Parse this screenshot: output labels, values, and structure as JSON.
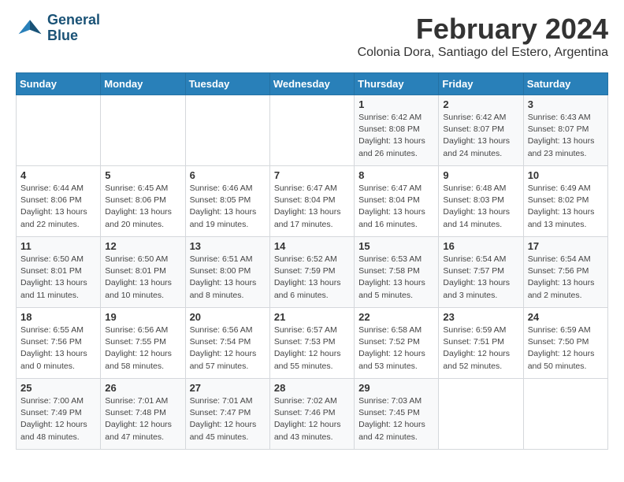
{
  "logo": {
    "line1": "General",
    "line2": "Blue"
  },
  "title": "February 2024",
  "location": "Colonia Dora, Santiago del Estero, Argentina",
  "days_of_week": [
    "Sunday",
    "Monday",
    "Tuesday",
    "Wednesday",
    "Thursday",
    "Friday",
    "Saturday"
  ],
  "weeks": [
    [
      {
        "day": "",
        "info": ""
      },
      {
        "day": "",
        "info": ""
      },
      {
        "day": "",
        "info": ""
      },
      {
        "day": "",
        "info": ""
      },
      {
        "day": "1",
        "info": "Sunrise: 6:42 AM\nSunset: 8:08 PM\nDaylight: 13 hours\nand 26 minutes."
      },
      {
        "day": "2",
        "info": "Sunrise: 6:42 AM\nSunset: 8:07 PM\nDaylight: 13 hours\nand 24 minutes."
      },
      {
        "day": "3",
        "info": "Sunrise: 6:43 AM\nSunset: 8:07 PM\nDaylight: 13 hours\nand 23 minutes."
      }
    ],
    [
      {
        "day": "4",
        "info": "Sunrise: 6:44 AM\nSunset: 8:06 PM\nDaylight: 13 hours\nand 22 minutes."
      },
      {
        "day": "5",
        "info": "Sunrise: 6:45 AM\nSunset: 8:06 PM\nDaylight: 13 hours\nand 20 minutes."
      },
      {
        "day": "6",
        "info": "Sunrise: 6:46 AM\nSunset: 8:05 PM\nDaylight: 13 hours\nand 19 minutes."
      },
      {
        "day": "7",
        "info": "Sunrise: 6:47 AM\nSunset: 8:04 PM\nDaylight: 13 hours\nand 17 minutes."
      },
      {
        "day": "8",
        "info": "Sunrise: 6:47 AM\nSunset: 8:04 PM\nDaylight: 13 hours\nand 16 minutes."
      },
      {
        "day": "9",
        "info": "Sunrise: 6:48 AM\nSunset: 8:03 PM\nDaylight: 13 hours\nand 14 minutes."
      },
      {
        "day": "10",
        "info": "Sunrise: 6:49 AM\nSunset: 8:02 PM\nDaylight: 13 hours\nand 13 minutes."
      }
    ],
    [
      {
        "day": "11",
        "info": "Sunrise: 6:50 AM\nSunset: 8:01 PM\nDaylight: 13 hours\nand 11 minutes."
      },
      {
        "day": "12",
        "info": "Sunrise: 6:50 AM\nSunset: 8:01 PM\nDaylight: 13 hours\nand 10 minutes."
      },
      {
        "day": "13",
        "info": "Sunrise: 6:51 AM\nSunset: 8:00 PM\nDaylight: 13 hours\nand 8 minutes."
      },
      {
        "day": "14",
        "info": "Sunrise: 6:52 AM\nSunset: 7:59 PM\nDaylight: 13 hours\nand 6 minutes."
      },
      {
        "day": "15",
        "info": "Sunrise: 6:53 AM\nSunset: 7:58 PM\nDaylight: 13 hours\nand 5 minutes."
      },
      {
        "day": "16",
        "info": "Sunrise: 6:54 AM\nSunset: 7:57 PM\nDaylight: 13 hours\nand 3 minutes."
      },
      {
        "day": "17",
        "info": "Sunrise: 6:54 AM\nSunset: 7:56 PM\nDaylight: 13 hours\nand 2 minutes."
      }
    ],
    [
      {
        "day": "18",
        "info": "Sunrise: 6:55 AM\nSunset: 7:56 PM\nDaylight: 13 hours\nand 0 minutes."
      },
      {
        "day": "19",
        "info": "Sunrise: 6:56 AM\nSunset: 7:55 PM\nDaylight: 12 hours\nand 58 minutes."
      },
      {
        "day": "20",
        "info": "Sunrise: 6:56 AM\nSunset: 7:54 PM\nDaylight: 12 hours\nand 57 minutes."
      },
      {
        "day": "21",
        "info": "Sunrise: 6:57 AM\nSunset: 7:53 PM\nDaylight: 12 hours\nand 55 minutes."
      },
      {
        "day": "22",
        "info": "Sunrise: 6:58 AM\nSunset: 7:52 PM\nDaylight: 12 hours\nand 53 minutes."
      },
      {
        "day": "23",
        "info": "Sunrise: 6:59 AM\nSunset: 7:51 PM\nDaylight: 12 hours\nand 52 minutes."
      },
      {
        "day": "24",
        "info": "Sunrise: 6:59 AM\nSunset: 7:50 PM\nDaylight: 12 hours\nand 50 minutes."
      }
    ],
    [
      {
        "day": "25",
        "info": "Sunrise: 7:00 AM\nSunset: 7:49 PM\nDaylight: 12 hours\nand 48 minutes."
      },
      {
        "day": "26",
        "info": "Sunrise: 7:01 AM\nSunset: 7:48 PM\nDaylight: 12 hours\nand 47 minutes."
      },
      {
        "day": "27",
        "info": "Sunrise: 7:01 AM\nSunset: 7:47 PM\nDaylight: 12 hours\nand 45 minutes."
      },
      {
        "day": "28",
        "info": "Sunrise: 7:02 AM\nSunset: 7:46 PM\nDaylight: 12 hours\nand 43 minutes."
      },
      {
        "day": "29",
        "info": "Sunrise: 7:03 AM\nSunset: 7:45 PM\nDaylight: 12 hours\nand 42 minutes."
      },
      {
        "day": "",
        "info": ""
      },
      {
        "day": "",
        "info": ""
      }
    ]
  ]
}
